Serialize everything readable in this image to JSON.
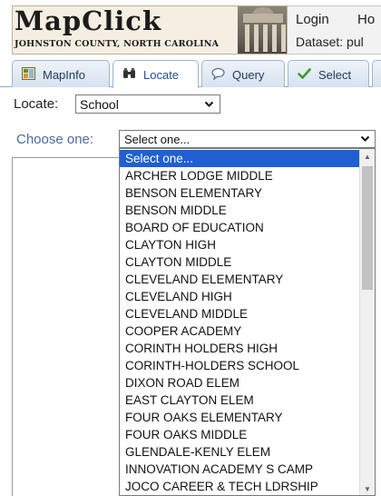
{
  "header": {
    "logo_title": "MapClick",
    "logo_subtitle": "JOHNSTON COUNTY, NORTH CAROLINA",
    "login_label": "Login",
    "home_label": "Ho",
    "dataset_text": "Dataset: pul"
  },
  "tabs": [
    {
      "label": "MapInfo",
      "icon": "map-info-icon",
      "active": false
    },
    {
      "label": "Locate",
      "icon": "binoculars-icon",
      "active": true
    },
    {
      "label": "Query",
      "icon": "speech-bubble-icon",
      "active": false
    },
    {
      "label": "Select",
      "icon": "checkmark-icon",
      "active": false
    }
  ],
  "locate": {
    "label": "Locate:",
    "selected": "School",
    "choose_label": "Choose one:",
    "choose_selected": "Select one..."
  },
  "dropdown": {
    "options": [
      "Select one...",
      "ARCHER LODGE MIDDLE",
      "BENSON ELEMENTARY",
      "BENSON MIDDLE",
      "BOARD OF EDUCATION",
      "CLAYTON HIGH",
      "CLAYTON MIDDLE",
      "CLEVELAND ELEMENTARY",
      "CLEVELAND HIGH",
      "CLEVELAND MIDDLE",
      "COOPER ACADEMY",
      "CORINTH HOLDERS HIGH",
      "CORINTH-HOLDERS SCHOOL",
      "DIXON ROAD ELEM",
      "EAST CLAYTON ELEM",
      "FOUR OAKS ELEMENTARY",
      "FOUR OAKS MIDDLE",
      "GLENDALE-KENLY ELEM",
      "INNOVATION ACADEMY S CAMP",
      "JOCO CAREER & TECH LDRSHIP"
    ],
    "highlighted_index": 0
  },
  "colors": {
    "highlight": "#1f5fd1",
    "choose_label": "#4a6aa0",
    "tab_active_text": "#1f4f9a"
  }
}
